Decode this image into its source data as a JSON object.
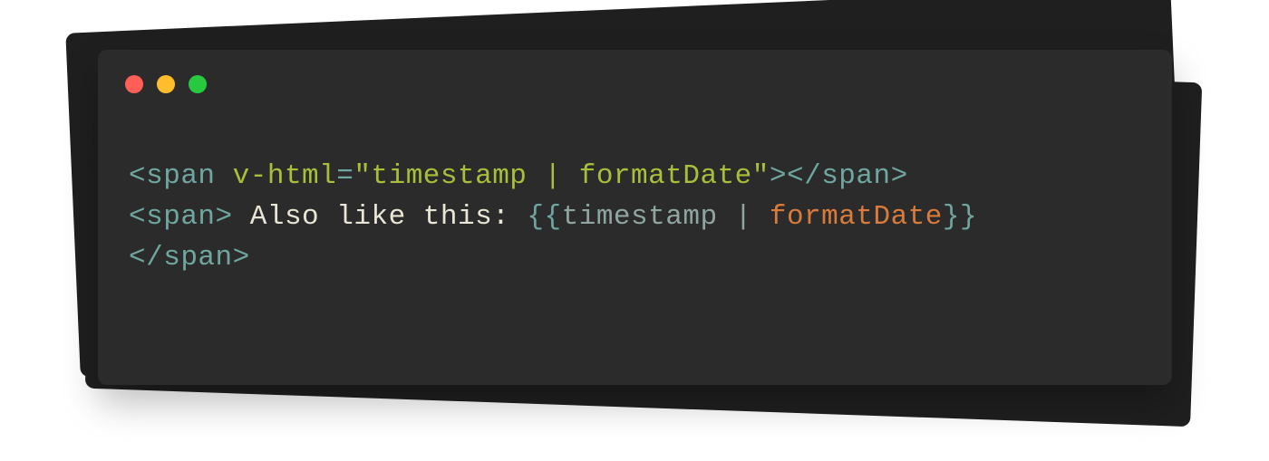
{
  "titlebar": {
    "close": "close",
    "minimize": "minimize",
    "zoom": "zoom"
  },
  "code": {
    "line1": {
      "lt1": "<",
      "tag1": "span",
      "sp1": " ",
      "attr": "v-html",
      "eq": "=",
      "q1": "\"",
      "val": "timestamp | formatDate",
      "q2": "\"",
      "gt1": ">",
      "lt2": "</",
      "tag2": "span",
      "gt2": ">"
    },
    "line2": {
      "lt1": "<",
      "tag1": "span",
      "gt1": ">",
      "text": " Also like this: ",
      "bb1": "{{",
      "var": "timestamp",
      "pipe": " | ",
      "fn": "formatDate",
      "bb2": "}}"
    },
    "line3": {
      "lt": "</",
      "tag": "span",
      "gt": ">"
    }
  }
}
